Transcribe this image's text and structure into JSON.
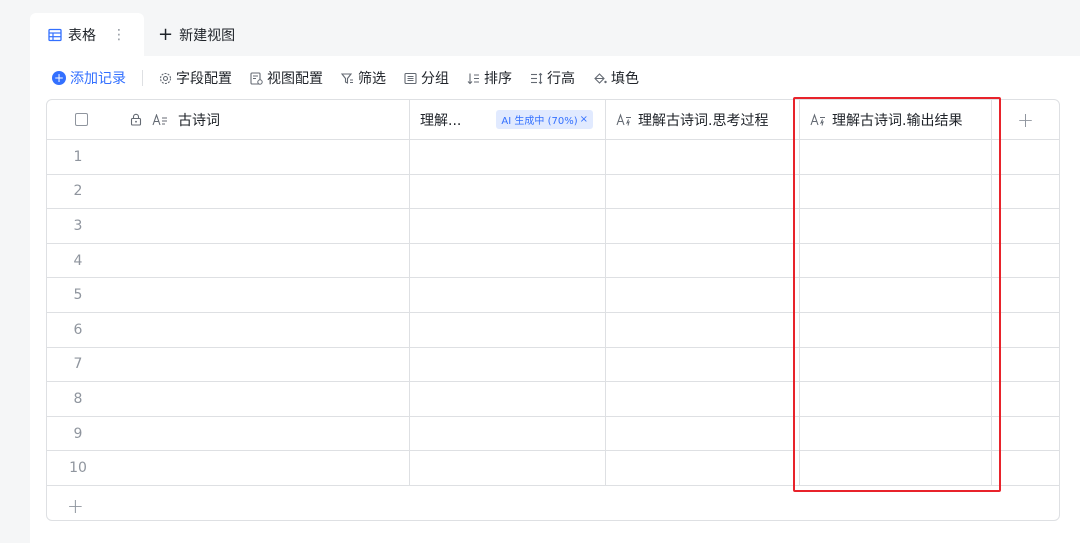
{
  "tabs": {
    "active_label": "表格",
    "more_glyph": "⋮",
    "new_view_label": "新建视图"
  },
  "toolbar": {
    "add_record": "添加记录",
    "field_config": "字段配置",
    "view_config": "视图配置",
    "filter": "筛选",
    "group": "分组",
    "sort": "排序",
    "row_height": "行高",
    "fill_color": "填色"
  },
  "columns": {
    "col1": "古诗词",
    "col2": "理解...",
    "col2_badge": "AI 生成中 (70%)",
    "col3": "理解古诗词.思考过程",
    "col4": "理解古诗词.输出结果"
  },
  "rows": [
    "1",
    "2",
    "3",
    "4",
    "5",
    "6",
    "7",
    "8",
    "9",
    "10"
  ],
  "colors": {
    "accent": "#3370ff",
    "highlight": "#e8232b"
  }
}
